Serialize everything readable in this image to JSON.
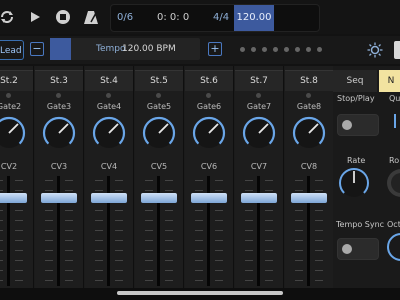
{
  "transport": {
    "step_counter": "0/6",
    "time": "0: 0: 0",
    "signature": "4/4",
    "tempo": "120.00"
  },
  "toolbar": {
    "preset_name": "Lead",
    "minus_label": "−",
    "plus_label": "+",
    "tempo_label": "Tempo",
    "tempo_value": "120.00 BPM",
    "tempo_fraction": 0.14
  },
  "channels": [
    {
      "name": "St.2",
      "gate": "Gate2",
      "cv": "CV2",
      "fader_level": 0.8
    },
    {
      "name": "St.3",
      "gate": "Gate3",
      "cv": "CV3",
      "fader_level": 0.8
    },
    {
      "name": "St.4",
      "gate": "Gate4",
      "cv": "CV4",
      "fader_level": 0.8
    },
    {
      "name": "St.5",
      "gate": "Gate5",
      "cv": "CV5",
      "fader_level": 0.8
    },
    {
      "name": "St.6",
      "gate": "Gate6",
      "cv": "CV6",
      "fader_level": 0.8
    },
    {
      "name": "St.7",
      "gate": "Gate7",
      "cv": "CV7",
      "fader_level": 0.8
    },
    {
      "name": "St.8",
      "gate": "Gate8",
      "cv": "CV8",
      "fader_level": 0.8
    }
  ],
  "right_panel": {
    "tab_seq": "Seq",
    "tab_next": "N",
    "stop_play_label": "Stop/Play",
    "qu_label": "Qu",
    "rate_label": "Rate",
    "ro_label": "Ro",
    "tempo_sync_label": "Tempo Sync",
    "oct_label": "Oct"
  },
  "colors": {
    "accent": "#3d5a9e",
    "accent_light": "#8fb0d8",
    "knob_arc": "#6aa6e8",
    "tab_active": "#f2e3a0"
  }
}
